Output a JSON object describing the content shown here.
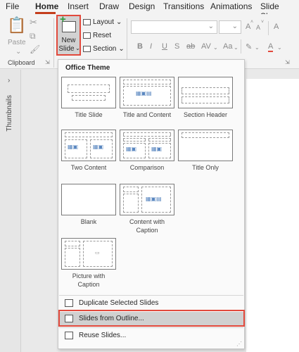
{
  "tabs": [
    "File",
    "Home",
    "Insert",
    "Draw",
    "Design",
    "Transitions",
    "Animations",
    "Slide Show"
  ],
  "active_tab": "Home",
  "ribbon": {
    "paste_label": "Paste",
    "clipboard_group_label": "Clipboard",
    "new_slide_label_line1": "New",
    "new_slide_label_line2": "Slide",
    "layout_label": "Layout",
    "reset_label": "Reset",
    "section_label": "Section",
    "bold": "B",
    "italic": "I",
    "underline": "U",
    "strikethrough": "S",
    "strike2": "ab",
    "char_spacing": "AV",
    "change_case": "Aa",
    "font_color": "A",
    "grow_font": "A",
    "shrink_font": "A",
    "accent_color": "#c43e1c"
  },
  "thumbnails_label": "Thumbnails",
  "menu": {
    "title": "Office Theme",
    "layouts": [
      {
        "name": "Title Slide"
      },
      {
        "name": "Title and Content"
      },
      {
        "name": "Section Header"
      },
      {
        "name": "Two Content"
      },
      {
        "name": "Comparison"
      },
      {
        "name": "Title Only"
      },
      {
        "name": "Blank"
      },
      {
        "name": "Content with Caption"
      },
      {
        "name": "Picture with Caption"
      }
    ],
    "items": [
      {
        "label": "Duplicate Selected Slides"
      },
      {
        "label": "Slides from Outline..."
      },
      {
        "label": "Reuse Slides..."
      }
    ],
    "highlight_color": "#e2493c"
  }
}
